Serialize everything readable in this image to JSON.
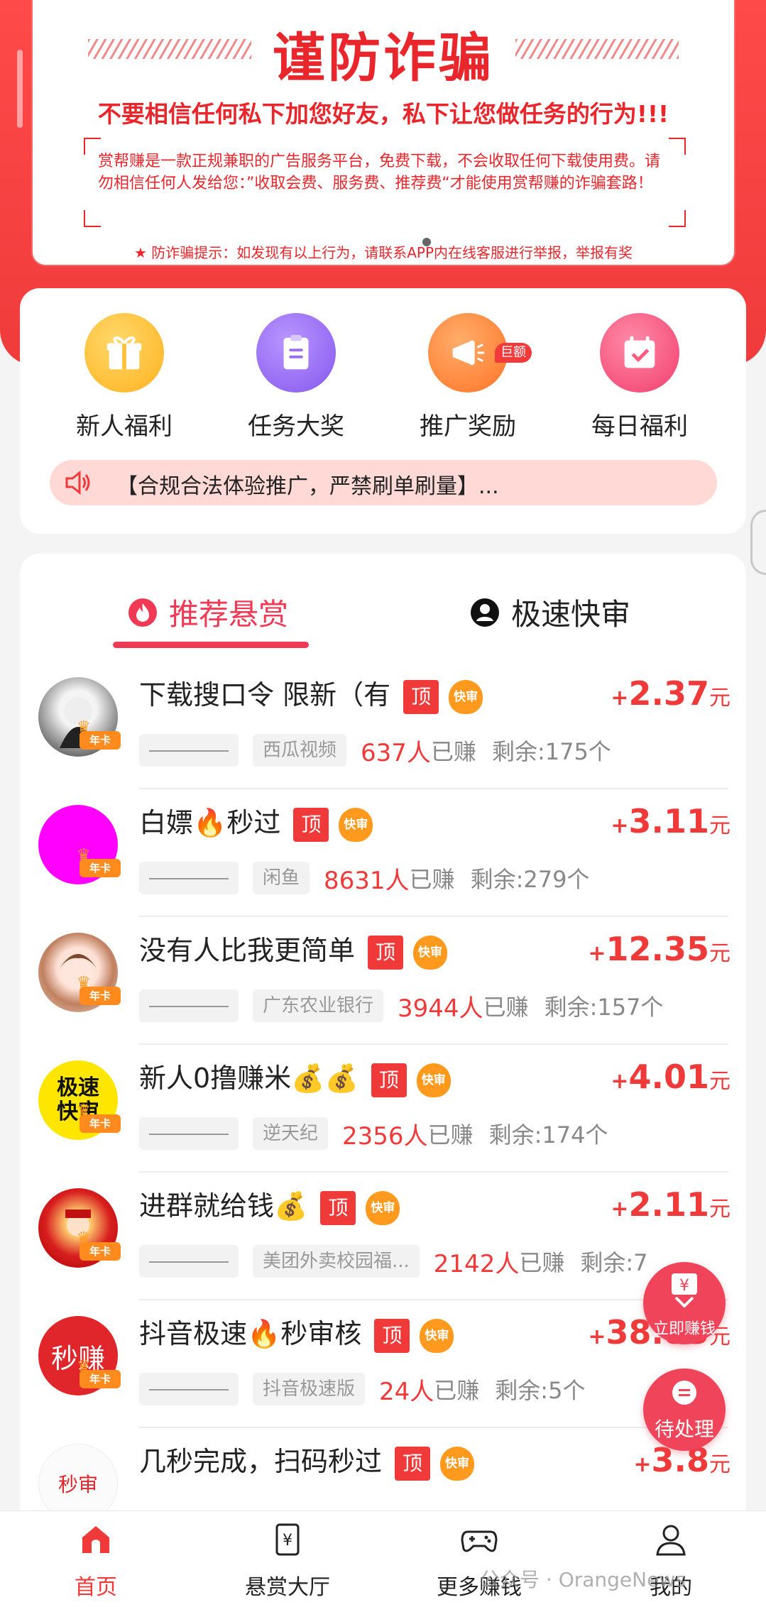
{
  "warning": {
    "title": "谨防诈骗",
    "subtitle": "不要相信任何私下加您好友，私下让您做任务的行为!!!",
    "body": "赏帮赚是一款正规兼职的广告服务平台，免费下载，不会收取任何下载使用费。请勿相信任何人发给您：”收取会费、服务费、推荐费“才能使用赏帮赚的诈骗套路！",
    "tip": "★ 防诈骗提示：如发现有以上行为，请联系APP内在线客服进行举报，举报有奖"
  },
  "quick_actions": [
    {
      "label": "新人福利",
      "icon": "gift-icon",
      "color": "#ffc23a"
    },
    {
      "label": "任务大奖",
      "icon": "clipboard-icon",
      "color": "#9a6df5"
    },
    {
      "label": "推广奖励",
      "icon": "megaphone-icon",
      "color": "#ff8a3a",
      "badge": "巨额"
    },
    {
      "label": "每日福利",
      "icon": "calendar-check-icon",
      "color": "#ff5a80"
    }
  ],
  "notice": {
    "icon": "speaker-icon",
    "text": "【合规合法体验推广，严禁刷单刷量】..."
  },
  "tabs": [
    {
      "label": "推荐悬赏",
      "icon": "flame-icon",
      "active": true
    },
    {
      "label": "极速快审",
      "icon": "person-icon",
      "active": false
    }
  ],
  "labels": {
    "top": "顶",
    "fast": "快审",
    "annual": "年卡",
    "earned": "已赚",
    "unit": "元"
  },
  "tasks": [
    {
      "title": "下载搜口令 限新（有",
      "price_sign": "+",
      "price": "2.37",
      "category": "西瓜视频",
      "count": "637人",
      "remaining": "剩余:175个",
      "avatar": "anime-avatar"
    },
    {
      "title": "白嫖🔥秒过",
      "price_sign": "+",
      "price": "3.11",
      "category": "闲鱼",
      "count": "8631人",
      "remaining": "剩余:279个",
      "avatar": "magenta-avatar"
    },
    {
      "title": "没有人比我更简单",
      "price_sign": "+",
      "price": "12.35",
      "category": "广东农业银行",
      "count": "3944人",
      "remaining": "剩余:157个",
      "avatar": "girl-avatar"
    },
    {
      "title": "新人0撸赚米💰💰",
      "price_sign": "+",
      "price": "4.01",
      "category": "逆天纪",
      "count": "2356人",
      "remaining": "剩余:174个",
      "avatar": "jisu-avatar",
      "avatar_text": "极速快审"
    },
    {
      "title": "进群就给钱💰",
      "price_sign": "+",
      "price": "2.11",
      "category": "美团外卖校园福...",
      "count": "2142人",
      "remaining": "剩余:7",
      "avatar": "fortune-avatar"
    },
    {
      "title": "抖音极速🔥秒审核",
      "price_sign": "+",
      "price": "38.83",
      "category": "抖音极速版",
      "count": "24人",
      "remaining": "剩余:5个",
      "avatar": "miaozhuan-avatar",
      "avatar_text": "秒赚"
    },
    {
      "title": "几秒完成，扫码秒过",
      "price_sign": "+",
      "price": "3.8",
      "category": "",
      "count": "",
      "remaining": "",
      "avatar": "miaoshen-avatar",
      "avatar_text": "秒审"
    }
  ],
  "float_buttons": [
    {
      "label": "立即赚钱",
      "icon": "yen-icon"
    },
    {
      "label": "待处理",
      "icon": "chat-icon"
    }
  ],
  "bottom_nav": [
    {
      "label": "首页",
      "icon": "home-icon",
      "active": true
    },
    {
      "label": "悬赏大厅",
      "icon": "yen-tag-icon",
      "active": false
    },
    {
      "label": "更多赚钱",
      "icon": "gamepad-icon",
      "active": false
    },
    {
      "label": "我的",
      "icon": "profile-icon",
      "active": false
    }
  ],
  "watermark": "公众号 · OrangeNews",
  "colors": {
    "accent": "#f03a3a",
    "tab_active": "#f03a55",
    "notice_bg": "#ffd9d6"
  }
}
